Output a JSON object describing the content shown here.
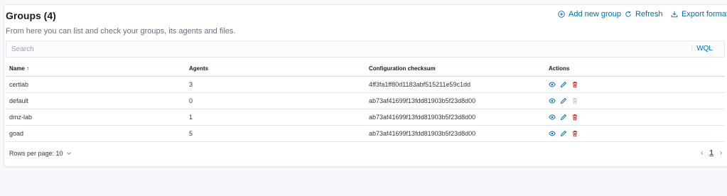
{
  "header": {
    "title": "Groups (4)",
    "subtitle": "From here you can list and check your groups, its agents and files.",
    "add_label": "Add new group",
    "refresh_label": "Refresh",
    "export_label": "Export formatted"
  },
  "search": {
    "placeholder": "Search",
    "wql_label": "WQL"
  },
  "table": {
    "headers": [
      "Name ↑",
      "Agents",
      "Configuration checksum",
      "Actions"
    ],
    "rows": [
      {
        "name": "certlab",
        "agents": "3",
        "checksum": "4ff3fa1ff80d1183abf515211e59c1dd",
        "delete_enabled": true
      },
      {
        "name": "default",
        "agents": "0",
        "checksum": "ab73af41699f13fdd81903b5f23d8d00",
        "delete_enabled": false
      },
      {
        "name": "dmz-lab",
        "agents": "1",
        "checksum": "ab73af41699f13fdd81903b5f23d8d00",
        "delete_enabled": true
      },
      {
        "name": "goad",
        "agents": "5",
        "checksum": "ab73af41699f13fdd81903b5f23d8d00",
        "delete_enabled": true
      }
    ]
  },
  "footer": {
    "rows_per_page": "Rows per page: 10",
    "current_page": "1"
  },
  "colors": {
    "link": "#006bb8",
    "danger": "#bd271e",
    "disabled": "#c2c7d0"
  }
}
